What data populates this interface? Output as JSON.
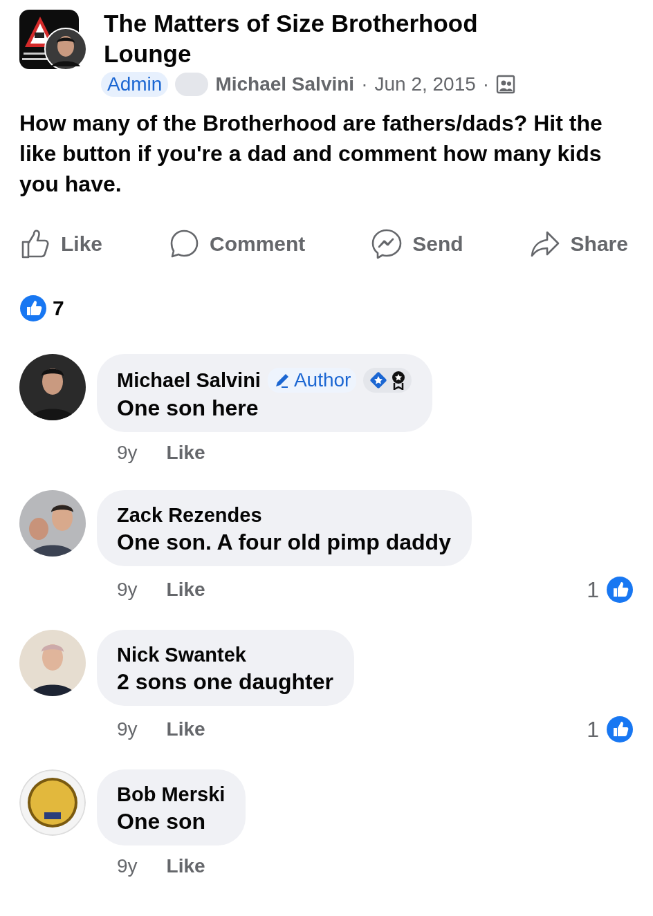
{
  "group": {
    "name": "The Matters of Size Brotherhood Lounge",
    "role_badge": "Admin",
    "author": "Michael Salvini",
    "separator": "·",
    "date": "Jun 2, 2015"
  },
  "post": {
    "text": "How many of the Brotherhood are fathers/dads? Hit the like button if you're a dad and comment how many kids you have."
  },
  "actions": [
    {
      "kind": "like",
      "label": "Like"
    },
    {
      "kind": "comment",
      "label": "Comment"
    },
    {
      "kind": "send",
      "label": "Send"
    },
    {
      "kind": "share",
      "label": "Share"
    }
  ],
  "reactions": {
    "count": "7"
  },
  "comments": [
    {
      "author": "Michael Salvini",
      "badge": "Author",
      "fan_badges": true,
      "text": "One son here",
      "time": "9y",
      "like": "Like"
    },
    {
      "author": "Zack Rezendes",
      "text": "One son. A four old pimp daddy",
      "time": "9y",
      "like": "Like",
      "likes": "1"
    },
    {
      "author": "Nick Swantek",
      "text": "2 sons one daughter",
      "time": "9y",
      "like": "Like",
      "likes": "1"
    },
    {
      "author": "Bob Merski",
      "text": "One son",
      "time": "9y",
      "like": "Like"
    }
  ]
}
